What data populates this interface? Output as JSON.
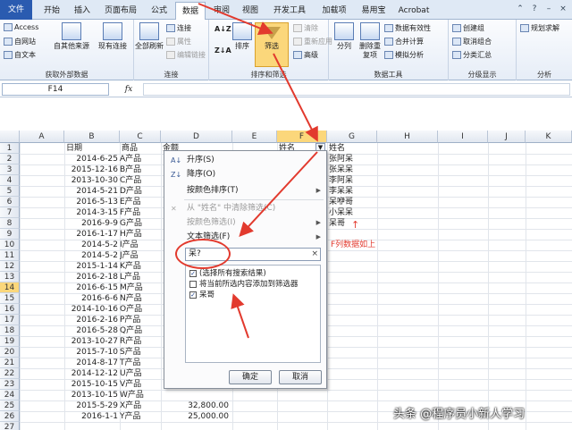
{
  "ribbon": {
    "tabs": [
      "文件",
      "开始",
      "插入",
      "页面布局",
      "公式",
      "数据",
      "审阅",
      "视图",
      "开发工具",
      "加载项",
      "易用宝",
      "Acrobat"
    ],
    "active_tab": "数据",
    "external": {
      "access": "Access",
      "web": "自网站",
      "text": "自文本",
      "other": "自其他来源",
      "existing": "现有连接",
      "label": "获取外部数据"
    },
    "connections": {
      "refresh": "全部刷新",
      "conn": "连接",
      "props": "属性",
      "edit_links": "编辑链接",
      "label": "连接"
    },
    "sortfilter": {
      "sort": "排序",
      "filter": "筛选",
      "clear": "清除",
      "reapply": "重新应用",
      "advanced": "高级",
      "label": "排序和筛选"
    },
    "datatools": {
      "split": "分列",
      "dedupe": "删除重复项",
      "validation": "数据有效性",
      "consolidate": "合并计算",
      "whatif": "模拟分析",
      "label": "数据工具"
    },
    "outline": {
      "group": "创建组",
      "ungroup": "取消组合",
      "subtotal": "分类汇总",
      "label": "分级显示"
    },
    "analysis": {
      "solver": "规划求解",
      "label": "分析"
    }
  },
  "formula_bar": {
    "name_box": "F14",
    "fx": "fx",
    "formula": ""
  },
  "sheet": {
    "columns": [
      "A",
      "B",
      "C",
      "D",
      "E",
      "F",
      "G",
      "H",
      "I",
      "J",
      "K"
    ],
    "header_row": {
      "date": "日期",
      "product": "商品",
      "amount": "金额",
      "name": "姓名",
      "name2": "姓名"
    },
    "rows": [
      {
        "date": "2014-6-25",
        "product": "A产品"
      },
      {
        "date": "2015-12-16",
        "product": "B产品"
      },
      {
        "date": "2013-10-30",
        "product": "C产品"
      },
      {
        "date": "2014-5-21",
        "product": "D产品"
      },
      {
        "date": "2016-5-13",
        "product": "E产品"
      },
      {
        "date": "2014-3-15",
        "product": "F产品"
      },
      {
        "date": "2016-9-9",
        "product": "G产品"
      },
      {
        "date": "2016-1-17",
        "product": "H产品"
      },
      {
        "date": "2014-5-2",
        "product": "I产品"
      },
      {
        "date": "2014-5-2",
        "product": "J产品"
      },
      {
        "date": "2015-1-14",
        "product": "K产品"
      },
      {
        "date": "2016-2-18",
        "product": "L产品"
      },
      {
        "date": "2016-6-15",
        "product": "M产品"
      },
      {
        "date": "2016-6-6",
        "product": "N产品"
      },
      {
        "date": "2014-10-16",
        "product": "O产品"
      },
      {
        "date": "2016-2-16",
        "product": "P产品"
      },
      {
        "date": "2016-5-28",
        "product": "Q产品"
      },
      {
        "date": "2013-10-27",
        "product": "R产品"
      },
      {
        "date": "2015-7-10",
        "product": "S产品"
      },
      {
        "date": "2014-8-17",
        "product": "T产品"
      },
      {
        "date": "2014-12-12",
        "product": "U产品"
      },
      {
        "date": "2015-10-15",
        "product": "V产品"
      },
      {
        "date": "2013-10-15",
        "product": "W产品"
      },
      {
        "date": "2015-5-29",
        "product": "X产品",
        "amount": "32,800.00"
      },
      {
        "date": "2016-1-1",
        "product": "Y产品",
        "amount": "25,000.00"
      }
    ],
    "g_column": [
      "张阿呆",
      "张呆呆",
      "李阿呆",
      "李呆呆",
      "呆咿哥",
      "小呆呆",
      "呆哥"
    ]
  },
  "filter_menu": {
    "sort_asc": "升序(S)",
    "sort_desc": "降序(O)",
    "sort_color": "按颜色排序(T)",
    "clear_filter": "从 \"姓名\" 中清除筛选(C)",
    "color_filter": "按颜色筛选(I)",
    "text_filter": "文本筛选(F)",
    "search_value": "呆?",
    "search_clear": "×",
    "options": [
      {
        "label": "(选择所有搜索结果)",
        "checked": "✓"
      },
      {
        "label": "将当前所选内容添加到筛选器",
        "checked": ""
      },
      {
        "label": "呆哥",
        "checked": "✓"
      }
    ],
    "ok": "确定",
    "cancel": "取消"
  },
  "annotation": {
    "text": "F列数据如上",
    "arrow_up": "↑"
  },
  "watermark": "头条 @程序员小新人学习",
  "colors": {
    "accent": "#e23a2e",
    "file_tab": "#2a5bb0",
    "selection": "#fbd77b"
  }
}
